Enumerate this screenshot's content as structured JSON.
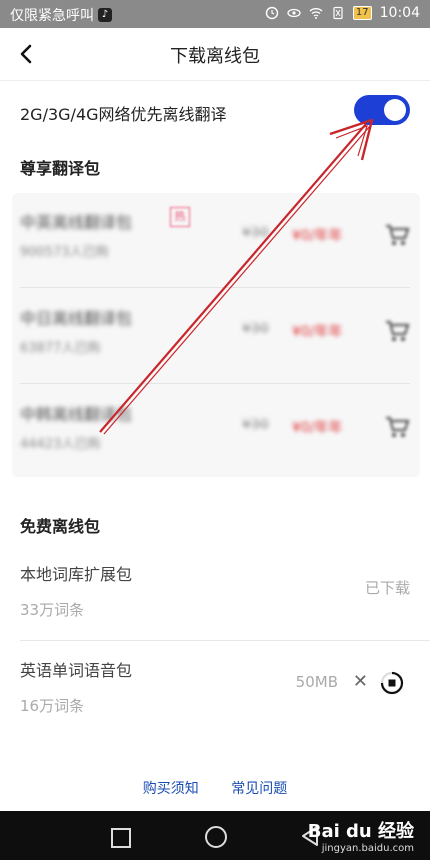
{
  "status_bar": {
    "carrier": "仅限紧急呼叫",
    "battery": "17",
    "time": "10:04"
  },
  "header": {
    "title": "下载离线包"
  },
  "toggle_row": {
    "label": "2G/3G/4G网络优先离线翻译",
    "enabled": true,
    "color": "#1d3fd6"
  },
  "premium": {
    "title": "尊享翻译包",
    "items": [
      {
        "name": "中英离线翻译包",
        "count": "900573人已购",
        "price": "¥30",
        "sale": "¥0/年年"
      },
      {
        "name": "中日离线翻译包",
        "count": "63877人已购",
        "price": "¥30",
        "sale": "¥0/年年"
      },
      {
        "name": "中韩离线翻译包",
        "count": "44423人已购",
        "price": "¥30",
        "sale": "¥0/年年"
      }
    ]
  },
  "free": {
    "title": "免费离线包",
    "items": [
      {
        "name": "本地词库扩展包",
        "count": "33万词条",
        "status": "已下载"
      },
      {
        "name": "英语单词语音包",
        "count": "16万词条",
        "size": "50MB"
      }
    ]
  },
  "footer": {
    "purchase_notes": "购买须知",
    "faq": "常见问题"
  },
  "watermark": {
    "brand": "Bai du 经验",
    "url": "jingyan.baidu.com"
  }
}
